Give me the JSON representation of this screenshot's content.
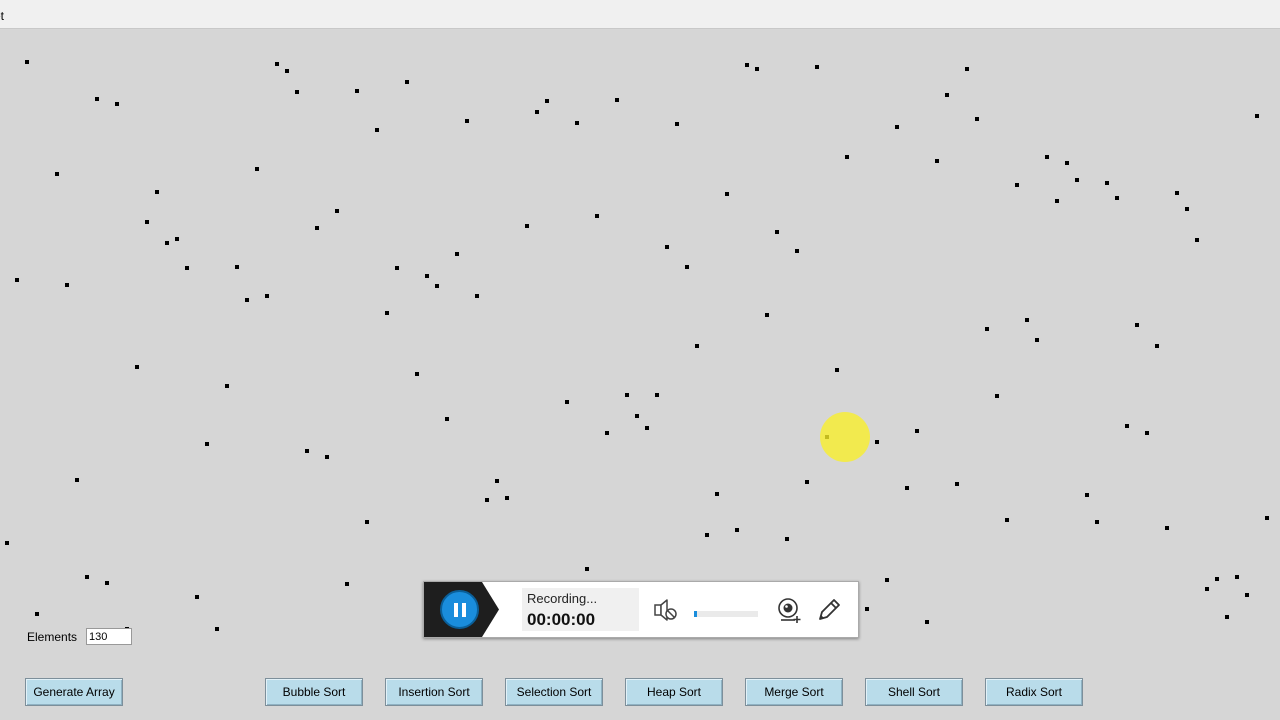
{
  "window": {
    "title_fragment": "et"
  },
  "controls": {
    "elements_label": "Elements",
    "elements_value": "130",
    "generate_label": "Generate Array"
  },
  "sort_buttons": [
    {
      "key": "bubble",
      "label": "Bubble Sort"
    },
    {
      "key": "insertion",
      "label": "Insertion Sort"
    },
    {
      "key": "selection",
      "label": "Selection Sort"
    },
    {
      "key": "heap",
      "label": "Heap Sort"
    },
    {
      "key": "merge",
      "label": "Merge Sort"
    },
    {
      "key": "shell",
      "label": "Shell Sort"
    },
    {
      "key": "radix",
      "label": "Radix Sort"
    }
  ],
  "recorder": {
    "status": "Recording...",
    "time": "00:00:00",
    "volume_level": 0.05,
    "icons": [
      "pause-icon",
      "speaker-muted-icon",
      "webcam-add-icon",
      "pencil-icon"
    ]
  },
  "colors": {
    "background": "#d6d6d6",
    "dot": "#000000",
    "button_fill": "#b9dcea",
    "accent": "#1a8ddc",
    "cursor_highlight": "#f5ea3c"
  }
}
